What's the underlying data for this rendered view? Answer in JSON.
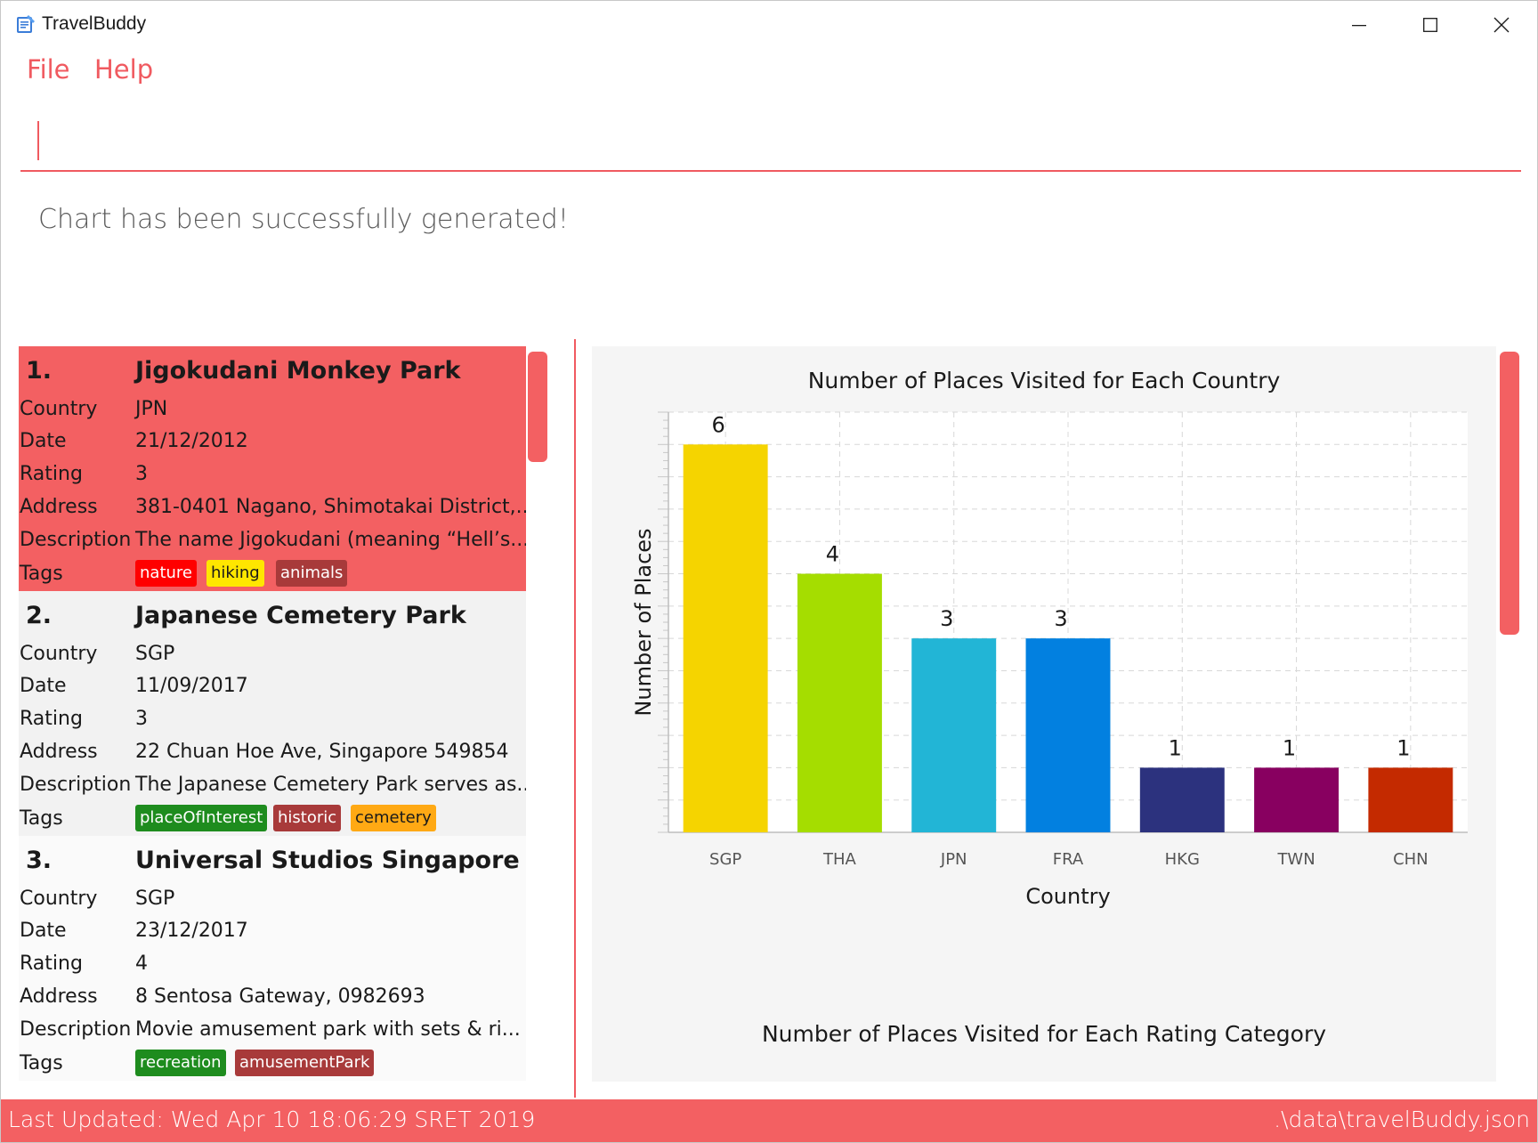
{
  "window": {
    "title": "TravelBuddy"
  },
  "menu": {
    "file": "File",
    "help": "Help"
  },
  "command": {
    "value": ""
  },
  "result": {
    "message": "Chart has been successfully generated!"
  },
  "labels": {
    "country": "Country",
    "date": "Date",
    "rating": "Rating",
    "address": "Address",
    "description": "Description",
    "tags": "Tags"
  },
  "places": [
    {
      "index": "1.",
      "name": "Jigokudani Monkey Park",
      "country": "JPN",
      "date": "21/12/2012",
      "rating": "3",
      "address": "381-0401 Nagano, Shimotakai District,...",
      "description": "The name Jigokudani (meaning “Hell’s...",
      "tags": [
        {
          "label": "nature",
          "color": "#ff0000"
        },
        {
          "label": "hiking",
          "color": "#ffe600"
        },
        {
          "label": "animals",
          "color": "#a83a3a"
        }
      ]
    },
    {
      "index": "2.",
      "name": "Japanese Cemetery Park",
      "country": "SGP",
      "date": "11/09/2017",
      "rating": "3",
      "address": "22 Chuan Hoe Ave, Singapore 549854",
      "description": "The Japanese Cemetery Park serves as...",
      "tags": [
        {
          "label": "placeOfInterest",
          "color": "#1e8c1e"
        },
        {
          "label": "historic",
          "color": "#a83a3a"
        },
        {
          "label": "cemetery",
          "color": "#ffa914"
        }
      ]
    },
    {
      "index": "3.",
      "name": "Universal Studios Singapore",
      "country": "SGP",
      "date": "23/12/2017",
      "rating": "4",
      "address": "8 Sentosa Gateway, 0982693",
      "description": "Movie amusement park with sets & ri...",
      "tags": [
        {
          "label": "recreation",
          "color": "#1e8c1e"
        },
        {
          "label": "amusementPark",
          "color": "#a83a3a"
        }
      ]
    }
  ],
  "chart_data": [
    {
      "type": "bar",
      "title": "Number of Places Visited for Each Country",
      "xlabel": "Country",
      "ylabel": "Number of Places",
      "categories": [
        "SGP",
        "THA",
        "JPN",
        "FRA",
        "HKG",
        "TWN",
        "CHN"
      ],
      "values": [
        6,
        4,
        3,
        3,
        1,
        1,
        1
      ],
      "colors": [
        "#f5d400",
        "#a5dd00",
        "#22b5d6",
        "#0280e0",
        "#2c327e",
        "#880060",
        "#c42a00"
      ],
      "ylim": [
        0,
        6.5
      ],
      "grid": true,
      "data_labels": true
    },
    {
      "type": "bar",
      "title": "Number of Places Visited for Each Rating Category"
    }
  ],
  "status": {
    "last_updated": "Last Updated: Wed Apr 10 18:06:29 SRET 2019",
    "file_path": ".\\data\\travelBuddy.json"
  }
}
